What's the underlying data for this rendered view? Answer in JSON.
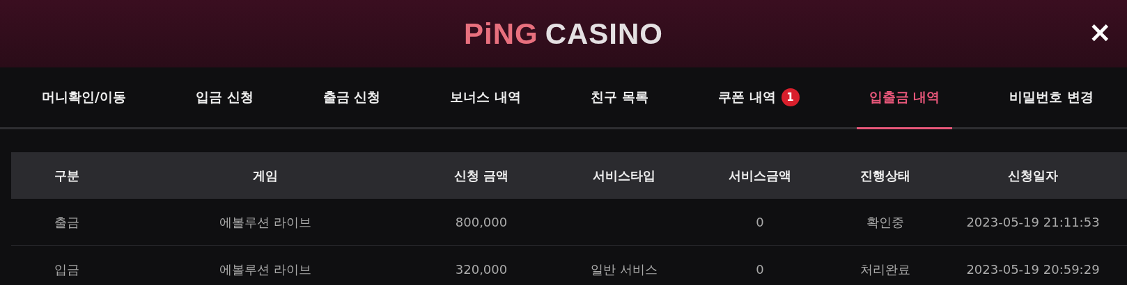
{
  "header": {
    "logo_accent": "PiNG",
    "logo_text": "CASINO",
    "close": "×"
  },
  "tabs": [
    {
      "label": "머니확인/이동",
      "selected": false
    },
    {
      "label": "입금 신청",
      "selected": false
    },
    {
      "label": "출금 신청",
      "selected": false
    },
    {
      "label": "보너스 내역",
      "selected": false
    },
    {
      "label": "친구 목록",
      "selected": false
    },
    {
      "label": "쿠폰 내역",
      "selected": false,
      "badge": "1"
    },
    {
      "label": "입출금 내역",
      "selected": true
    },
    {
      "label": "비밀번호 변경",
      "selected": false
    }
  ],
  "table": {
    "columns": [
      "구분",
      "게임",
      "신청 금액",
      "서비스타입",
      "서비스금액",
      "진행상태",
      "신청일자"
    ],
    "rows": [
      [
        "출금",
        "에볼루션 라이브",
        "800,000",
        "",
        "0",
        "확인중",
        "2023-05-19 21:11:53"
      ],
      [
        "입금",
        "에볼루션 라이브",
        "320,000",
        "일반 서비스",
        "0",
        "처리완료",
        "2023-05-19 20:59:29"
      ]
    ]
  }
}
